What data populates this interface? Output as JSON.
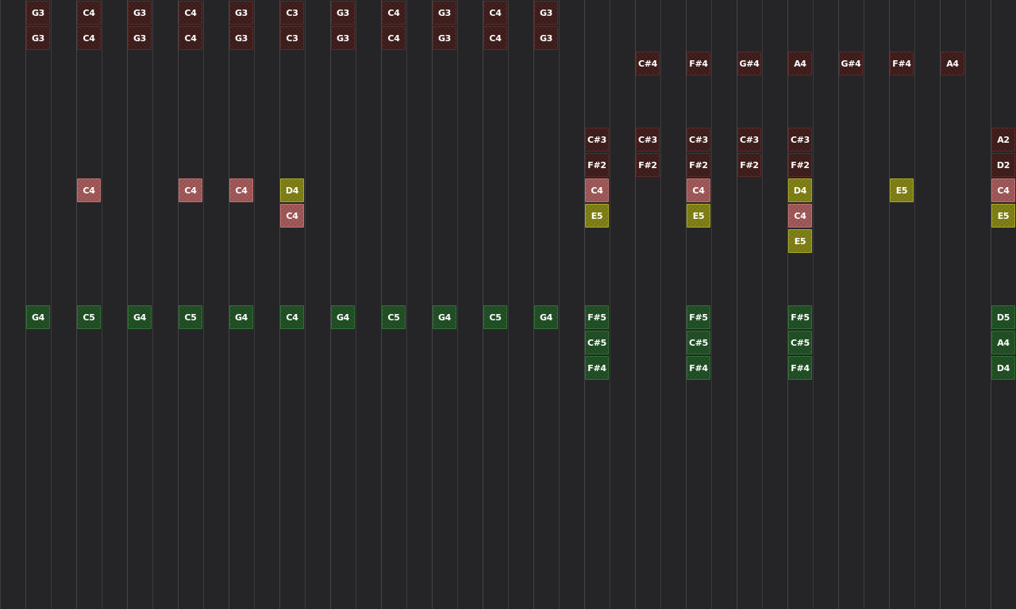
{
  "colors": {
    "background": "#252528",
    "gridline": "#3b3b3f",
    "dark": "#3d1c1a",
    "pink": "#a05757",
    "yellow": "#7f7f14",
    "green": "#1f4e23"
  },
  "grid": {
    "columns": 20,
    "rows": 24
  },
  "notes": [
    {
      "label": "G3",
      "col": 0,
      "row": 0,
      "color": "dark"
    },
    {
      "label": "G3",
      "col": 0,
      "row": 1,
      "color": "dark"
    },
    {
      "label": "G4",
      "col": 0,
      "row": 12,
      "color": "green"
    },
    {
      "label": "C4",
      "col": 1,
      "row": 0,
      "color": "dark"
    },
    {
      "label": "C4",
      "col": 1,
      "row": 1,
      "color": "dark"
    },
    {
      "label": "C4",
      "col": 1,
      "row": 7,
      "color": "pink"
    },
    {
      "label": "C5",
      "col": 1,
      "row": 12,
      "color": "green"
    },
    {
      "label": "G3",
      "col": 2,
      "row": 0,
      "color": "dark"
    },
    {
      "label": "G3",
      "col": 2,
      "row": 1,
      "color": "dark"
    },
    {
      "label": "G4",
      "col": 2,
      "row": 12,
      "color": "green"
    },
    {
      "label": "C4",
      "col": 3,
      "row": 0,
      "color": "dark"
    },
    {
      "label": "C4",
      "col": 3,
      "row": 1,
      "color": "dark"
    },
    {
      "label": "C4",
      "col": 3,
      "row": 7,
      "color": "pink"
    },
    {
      "label": "C5",
      "col": 3,
      "row": 12,
      "color": "green"
    },
    {
      "label": "G3",
      "col": 4,
      "row": 0,
      "color": "dark"
    },
    {
      "label": "G3",
      "col": 4,
      "row": 1,
      "color": "dark"
    },
    {
      "label": "C4",
      "col": 4,
      "row": 7,
      "color": "pink"
    },
    {
      "label": "G4",
      "col": 4,
      "row": 12,
      "color": "green"
    },
    {
      "label": "C3",
      "col": 5,
      "row": 0,
      "color": "dark"
    },
    {
      "label": "C3",
      "col": 5,
      "row": 1,
      "color": "dark"
    },
    {
      "label": "D4",
      "col": 5,
      "row": 7,
      "color": "yellow"
    },
    {
      "label": "C4",
      "col": 5,
      "row": 8,
      "color": "pink"
    },
    {
      "label": "C4",
      "col": 5,
      "row": 12,
      "color": "green"
    },
    {
      "label": "G3",
      "col": 6,
      "row": 0,
      "color": "dark"
    },
    {
      "label": "G3",
      "col": 6,
      "row": 1,
      "color": "dark"
    },
    {
      "label": "G4",
      "col": 6,
      "row": 12,
      "color": "green"
    },
    {
      "label": "C4",
      "col": 7,
      "row": 0,
      "color": "dark"
    },
    {
      "label": "C4",
      "col": 7,
      "row": 1,
      "color": "dark"
    },
    {
      "label": "C5",
      "col": 7,
      "row": 12,
      "color": "green"
    },
    {
      "label": "G3",
      "col": 8,
      "row": 0,
      "color": "dark"
    },
    {
      "label": "G3",
      "col": 8,
      "row": 1,
      "color": "dark"
    },
    {
      "label": "G4",
      "col": 8,
      "row": 12,
      "color": "green"
    },
    {
      "label": "C4",
      "col": 9,
      "row": 0,
      "color": "dark"
    },
    {
      "label": "C4",
      "col": 9,
      "row": 1,
      "color": "dark"
    },
    {
      "label": "C5",
      "col": 9,
      "row": 12,
      "color": "green"
    },
    {
      "label": "G3",
      "col": 10,
      "row": 0,
      "color": "dark"
    },
    {
      "label": "G3",
      "col": 10,
      "row": 1,
      "color": "dark"
    },
    {
      "label": "G4",
      "col": 10,
      "row": 12,
      "color": "green"
    },
    {
      "label": "C#3",
      "col": 11,
      "row": 5,
      "color": "dark"
    },
    {
      "label": "F#2",
      "col": 11,
      "row": 6,
      "color": "dark"
    },
    {
      "label": "C4",
      "col": 11,
      "row": 7,
      "color": "pink"
    },
    {
      "label": "E5",
      "col": 11,
      "row": 8,
      "color": "yellow"
    },
    {
      "label": "F#5",
      "col": 11,
      "row": 12,
      "color": "green"
    },
    {
      "label": "C#5",
      "col": 11,
      "row": 13,
      "color": "green"
    },
    {
      "label": "F#4",
      "col": 11,
      "row": 14,
      "color": "green"
    },
    {
      "label": "C#4",
      "col": 12,
      "row": 2,
      "color": "dark"
    },
    {
      "label": "C#3",
      "col": 12,
      "row": 5,
      "color": "dark"
    },
    {
      "label": "F#2",
      "col": 12,
      "row": 6,
      "color": "dark"
    },
    {
      "label": "F#4",
      "col": 13,
      "row": 2,
      "color": "dark"
    },
    {
      "label": "C#3",
      "col": 13,
      "row": 5,
      "color": "dark"
    },
    {
      "label": "F#2",
      "col": 13,
      "row": 6,
      "color": "dark"
    },
    {
      "label": "C4",
      "col": 13,
      "row": 7,
      "color": "pink"
    },
    {
      "label": "E5",
      "col": 13,
      "row": 8,
      "color": "yellow"
    },
    {
      "label": "F#5",
      "col": 13,
      "row": 12,
      "color": "green"
    },
    {
      "label": "C#5",
      "col": 13,
      "row": 13,
      "color": "green"
    },
    {
      "label": "F#4",
      "col": 13,
      "row": 14,
      "color": "green"
    },
    {
      "label": "G#4",
      "col": 14,
      "row": 2,
      "color": "dark"
    },
    {
      "label": "C#3",
      "col": 14,
      "row": 5,
      "color": "dark"
    },
    {
      "label": "F#2",
      "col": 14,
      "row": 6,
      "color": "dark"
    },
    {
      "label": "A4",
      "col": 15,
      "row": 2,
      "color": "dark"
    },
    {
      "label": "C#3",
      "col": 15,
      "row": 5,
      "color": "dark"
    },
    {
      "label": "F#2",
      "col": 15,
      "row": 6,
      "color": "dark"
    },
    {
      "label": "D4",
      "col": 15,
      "row": 7,
      "color": "yellow"
    },
    {
      "label": "C4",
      "col": 15,
      "row": 8,
      "color": "pink"
    },
    {
      "label": "E5",
      "col": 15,
      "row": 9,
      "color": "yellow"
    },
    {
      "label": "F#5",
      "col": 15,
      "row": 12,
      "color": "green"
    },
    {
      "label": "C#5",
      "col": 15,
      "row": 13,
      "color": "green"
    },
    {
      "label": "F#4",
      "col": 15,
      "row": 14,
      "color": "green"
    },
    {
      "label": "G#4",
      "col": 16,
      "row": 2,
      "color": "dark"
    },
    {
      "label": "F#4",
      "col": 17,
      "row": 2,
      "color": "dark"
    },
    {
      "label": "E5",
      "col": 17,
      "row": 7,
      "color": "yellow"
    },
    {
      "label": "A4",
      "col": 18,
      "row": 2,
      "color": "dark"
    },
    {
      "label": "A2",
      "col": 19,
      "row": 5,
      "color": "dark"
    },
    {
      "label": "D2",
      "col": 19,
      "row": 6,
      "color": "dark"
    },
    {
      "label": "C4",
      "col": 19,
      "row": 7,
      "color": "pink"
    },
    {
      "label": "E5",
      "col": 19,
      "row": 8,
      "color": "yellow"
    },
    {
      "label": "D5",
      "col": 19,
      "row": 12,
      "color": "green"
    },
    {
      "label": "A4",
      "col": 19,
      "row": 13,
      "color": "green"
    },
    {
      "label": "D4",
      "col": 19,
      "row": 14,
      "color": "green"
    }
  ]
}
